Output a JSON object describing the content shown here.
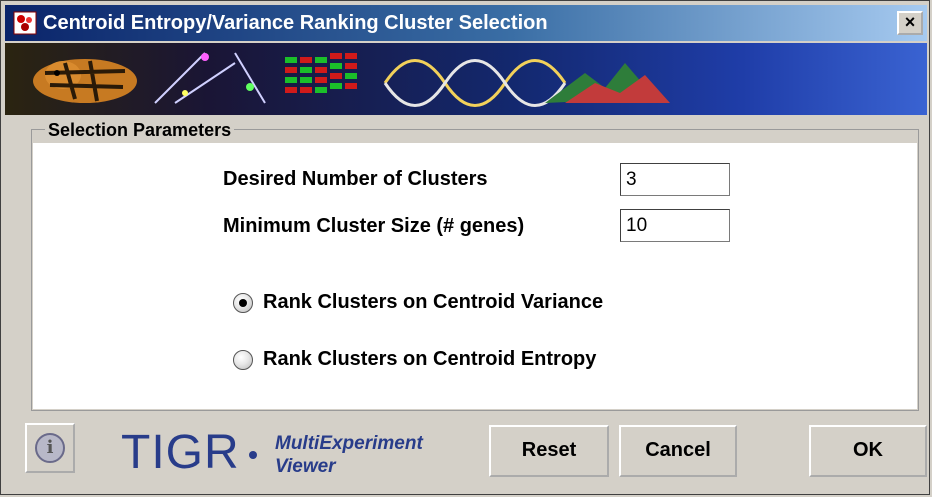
{
  "window": {
    "title": "Centroid Entropy/Variance Ranking Cluster Selection",
    "close_label": "×"
  },
  "params": {
    "legend": "Selection Parameters",
    "clusters_label": "Desired Number of Clusters",
    "clusters_value": "3",
    "min_size_label": "Minimum Cluster Size (# genes)",
    "min_size_value": "10"
  },
  "ranking": {
    "options": [
      {
        "label": "Rank Clusters on Centroid Variance",
        "selected": true
      },
      {
        "label": "Rank Clusters on Centroid Entropy",
        "selected": false
      }
    ]
  },
  "footer": {
    "info_icon": "info-icon",
    "logo_main": "TIGR",
    "logo_line1": "MultiExperiment",
    "logo_line2": "Viewer",
    "reset_label": "Reset",
    "cancel_label": "Cancel",
    "ok_label": "OK"
  },
  "colors": {
    "titlebar_start": "#0a246a",
    "titlebar_end": "#a6caf0",
    "logo_blue": "#283c8a"
  }
}
